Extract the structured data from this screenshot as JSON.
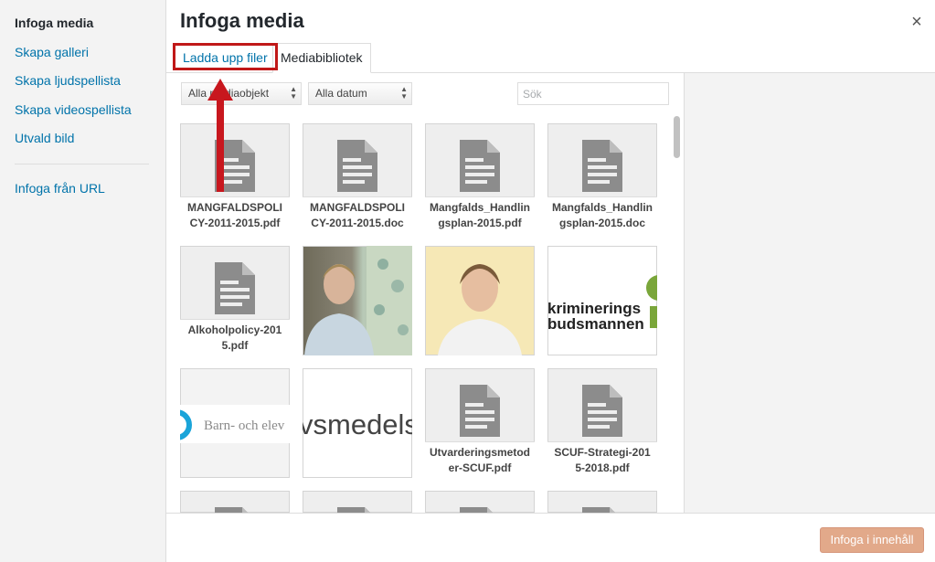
{
  "menu": {
    "items": [
      {
        "label": "Infoga media",
        "active": true
      },
      {
        "label": "Skapa galleri"
      },
      {
        "label": "Skapa ljudspellista"
      },
      {
        "label": "Skapa videospellista"
      },
      {
        "label": "Utvald bild"
      },
      {
        "label": "Infoga från URL"
      }
    ]
  },
  "header": {
    "title": "Infoga media",
    "close_symbol": "×"
  },
  "tabs": [
    {
      "label": "Ladda upp filer",
      "highlighted": true
    },
    {
      "label": "Mediabibliotek",
      "active": true
    }
  ],
  "toolbar": {
    "type_filter": "Alla mediaobjekt",
    "date_filter": "Alla datum",
    "search_placeholder": "Sök"
  },
  "media": [
    {
      "kind": "file",
      "name": "MANGFALDSPOLICY-2011-2015.pdf"
    },
    {
      "kind": "file",
      "name": "MANGFALDSPOLICY-2011-2015.doc"
    },
    {
      "kind": "file",
      "name": "Mangfalds_Handlingsplan-2015.pdf"
    },
    {
      "kind": "file",
      "name": "Mangfalds_Handlingsplan-2015.doc"
    },
    {
      "kind": "file",
      "name": "Alkoholpolicy-2015.pdf"
    },
    {
      "kind": "image",
      "name": ""
    },
    {
      "kind": "image",
      "name": ""
    },
    {
      "kind": "image",
      "text_lines": [
        "kriminerings",
        "budsmannen"
      ]
    },
    {
      "kind": "image",
      "text": "Barn- och elev"
    },
    {
      "kind": "image",
      "text": "vsmedelsv"
    },
    {
      "kind": "file",
      "name": "Utvarderingsmetoder-SCUF.pdf"
    },
    {
      "kind": "file",
      "name": "SCUF-Strategi-2015-2018.pdf"
    }
  ],
  "footer": {
    "insert_button": "Infoga i innehåll"
  },
  "colors": {
    "link": "#0073aa",
    "highlight_border": "#c01818",
    "insert_button": "#e2a98a"
  }
}
